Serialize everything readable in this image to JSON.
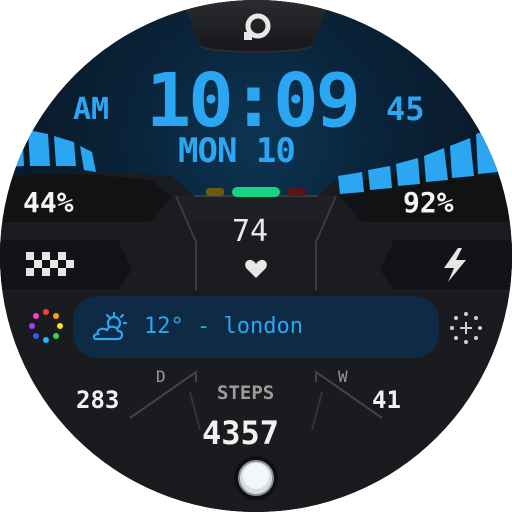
{
  "watch": {
    "time": "10:09",
    "ampm": "AM",
    "seconds": "45",
    "date": "MON 10",
    "battery_left": "44%",
    "battery_right": "92%",
    "heart_rate": "74",
    "weather": "12° - london",
    "day_label": "D",
    "day_value": "283",
    "week_label": "W",
    "week_value": "41",
    "steps_label": "STEPS",
    "steps_value": "4357"
  },
  "colors": {
    "accent": "#2aa6f2",
    "background": "#1b1d20",
    "indicator_green": "#19d384",
    "indicator_yellow": "#6b5a12",
    "indicator_red": "#5a1414"
  },
  "icons": [
    "app-launcher-icon",
    "checkered-flag-icon",
    "lightning-icon",
    "color-dots-icon",
    "sun-cloud-icon",
    "heart-icon",
    "sparkle-dots-icon",
    "home-button-icon"
  ]
}
